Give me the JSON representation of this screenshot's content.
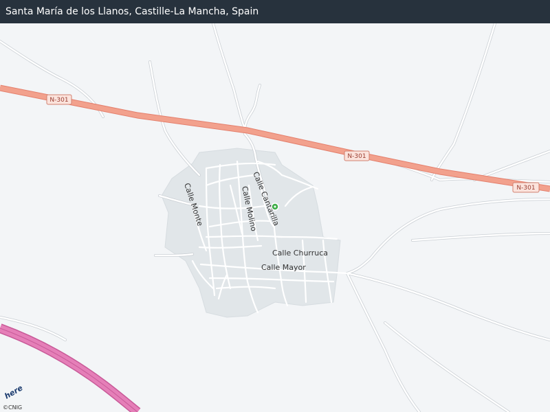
{
  "title": "Santa María de los Llanos, Castille-La Mancha, Spain",
  "highways": [
    {
      "id": "n301-a",
      "label": "N-301"
    },
    {
      "id": "n301-b",
      "label": "N-301"
    },
    {
      "id": "n301-c",
      "label": "N-301"
    }
  ],
  "streets": {
    "calle_cantarilla": "Calle  Cantarilla",
    "calle_monte": "Calle  Monte",
    "calle_molino": "Calle  Molino",
    "calle_churruca": "Calle  Churruca",
    "calle_mayor": "Calle  Mayor"
  },
  "logo": "here",
  "attribution": "©CNIG",
  "colors": {
    "background": "#f3f5f7",
    "urban_area": "#e1e6e9",
    "highway": "#f2a18d",
    "motorway": "#e57fb8",
    "minor_road": "#ffffff",
    "marker": "#3fae49"
  }
}
